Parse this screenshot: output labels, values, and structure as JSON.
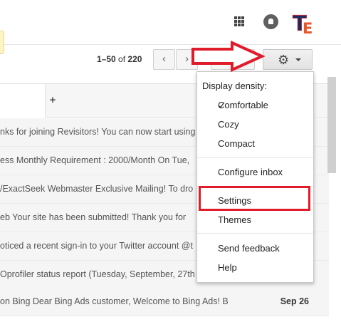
{
  "header": {
    "apps_icon": "apps-grid-icon",
    "notifications_icon": "bell-icon",
    "avatar_letters": "TE"
  },
  "pagination": {
    "range": "1–50",
    "of": "of",
    "total": "220",
    "prev_icon": "chevron-left-icon",
    "next_icon": "chevron-right-icon"
  },
  "toolbar": {
    "gear_glyph": "⚙"
  },
  "tabs": {
    "add_label": "+"
  },
  "emails": [
    {
      "snippet": "nks for joining Revisitors! You can now start using",
      "date": ""
    },
    {
      "snippet": "ess Monthly Requirement : 2000/Month On Tue,",
      "date": ""
    },
    {
      "snippet": "/ExactSeek Webmaster Exclusive Mailing! To dro",
      "date": ""
    },
    {
      "snippet": "eb Your site has been submitted! Thank you for",
      "date": ""
    },
    {
      "snippet": "oticed a recent sign-in to your Twitter account @t",
      "date": ""
    },
    {
      "snippet": "Oprofiler status report (Tuesday, September, 27th",
      "date": ""
    },
    {
      "snippet": "on Bing Dear Bing Ads customer, Welcome to Bing Ads! B",
      "date": "Sep 26"
    }
  ],
  "settings_menu": {
    "density_header": "Display density:",
    "check_glyph": "✓",
    "comfortable": "Comfortable",
    "cozy": "Cozy",
    "compact": "Compact",
    "configure_inbox": "Configure inbox",
    "settings": "Settings",
    "themes": "Themes",
    "send_feedback": "Send feedback",
    "help": "Help"
  },
  "annotation": {
    "color": "#e01b2a"
  }
}
